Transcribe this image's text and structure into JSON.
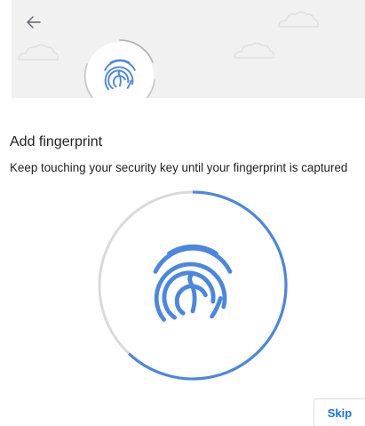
{
  "colors": {
    "accent": "#4b87df",
    "track": "#dadada",
    "header_background": "#f1f1f1",
    "button_text": "#1a73e8"
  },
  "icons": {
    "back": "arrow-left-icon",
    "fingerprint": "fingerprint-icon",
    "cloud": "cloud-icon"
  },
  "dialog": {
    "title": "Add fingerprint",
    "description": "Keep touching your security key until your fingerprint is captured"
  },
  "enrollment": {
    "progress_fraction": 0.62
  },
  "footer": {
    "skip_label": "Skip"
  }
}
